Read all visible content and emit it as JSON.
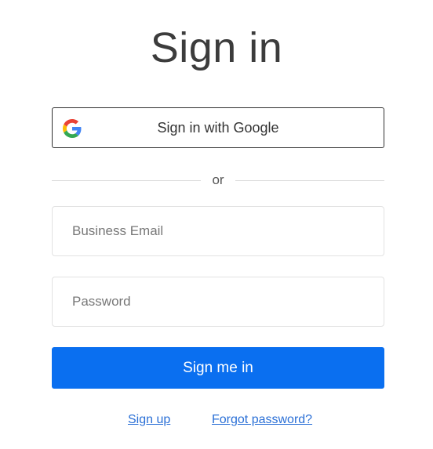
{
  "page": {
    "title": "Sign in"
  },
  "google_button": {
    "label": "Sign in with Google",
    "icon": "google-g-icon"
  },
  "divider": {
    "text": "or"
  },
  "form": {
    "email_placeholder": "Business Email",
    "email_value": "",
    "password_placeholder": "Password",
    "password_value": "",
    "submit_label": "Sign me in"
  },
  "links": {
    "sign_up": "Sign up",
    "forgot_password": "Forgot password?"
  },
  "colors": {
    "primary": "#0a6ff0",
    "link": "#2a6fd6",
    "title": "#3c3c3c"
  }
}
